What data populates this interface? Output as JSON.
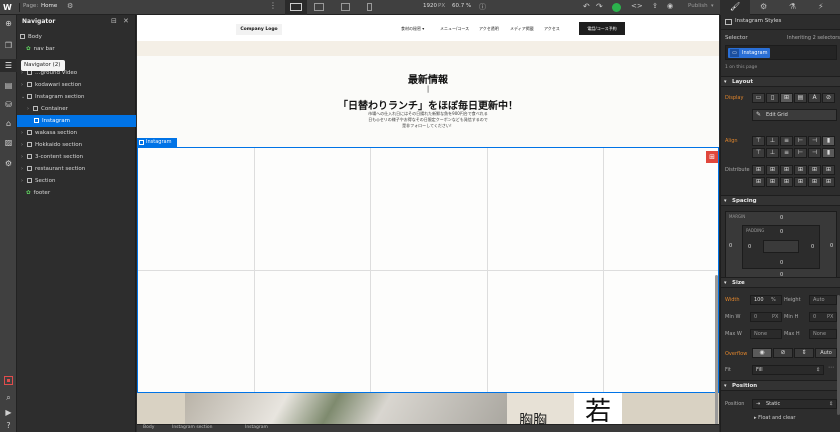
{
  "topbar": {
    "page_label": "Page:",
    "page_name": "Home",
    "width_value": "1920",
    "width_unit": "PX",
    "zoom": "60.7 %",
    "publish_label": "Publish"
  },
  "navigator": {
    "title": "Navigator",
    "tooltip": "Navigator (2)",
    "items": [
      {
        "label": "Body"
      },
      {
        "label": "nav bar"
      },
      {
        "label": "…ground Video"
      },
      {
        "label": "kodawari section"
      },
      {
        "label": "Instagram section"
      },
      {
        "label": "Container"
      },
      {
        "label": "Instagram"
      },
      {
        "label": "wakasa section"
      },
      {
        "label": "Hokkaido section"
      },
      {
        "label": "3-content section"
      },
      {
        "label": "restaurant section"
      },
      {
        "label": "Section"
      },
      {
        "label": "footer"
      }
    ]
  },
  "site": {
    "logo": "Company Logo",
    "menu": [
      "食材の秘密 ▾",
      "メニュー/コース",
      "アクセ透明",
      "メディア掲載",
      "アクセス"
    ],
    "cta": "電話/コース予約",
    "heading": "最新情報",
    "divider": "|",
    "subheading": "「日替わりランチ」をほぼ毎日更新中！",
    "desc_line1": "市場への仕入れ日にはその日揚れた新鮮な魚を900円台で食べれる",
    "desc_line2": "日も◎セリの様子やお得なその日限定クーポンなども発信するので",
    "desc_line3": "是非フォローしてください！",
    "instagram_tag": "Instagram",
    "photo_text1": "胸胸",
    "photo_text2": "若"
  },
  "breadcrumb": [
    "Body",
    "Instagram section",
    "Instagram"
  ],
  "style_panel": {
    "title": "Instagram Styles",
    "selector_label": "Selector",
    "inheriting": "Inheriting 2 selectors",
    "class_chip": "Instagram",
    "on_page": "1 on this page",
    "layout_title": "Layout",
    "display_label": "Display",
    "edit_grid": "Edit Grid",
    "align_label": "Align",
    "distribute_label": "Distribute",
    "spacing_title": "Spacing",
    "margin_label": "MARGIN",
    "padding_label": "PADDING",
    "zero": "0",
    "size_title": "Size",
    "width_label": "Width",
    "width_value": "100",
    "width_unit": "%",
    "height_label": "Height",
    "height_value": "Auto",
    "minw_label": "Min W",
    "minw_value": "0",
    "minw_unit": "PX",
    "minh_label": "Min H",
    "minh_value": "0",
    "minh_unit": "PX",
    "maxw_label": "Max W",
    "maxw_value": "None",
    "maxh_label": "Max H",
    "maxh_value": "None",
    "overflow_label": "Overflow",
    "overflow_auto": "Auto",
    "fit_label": "Fit",
    "fit_value": "Fill",
    "position_title": "Position",
    "position_label": "Position",
    "position_value": "Static",
    "float_clear": "Float and clear"
  },
  "colors": {
    "accent_blue": "#0073e6",
    "orange": "#e0852c",
    "green": "#2bb24c"
  }
}
